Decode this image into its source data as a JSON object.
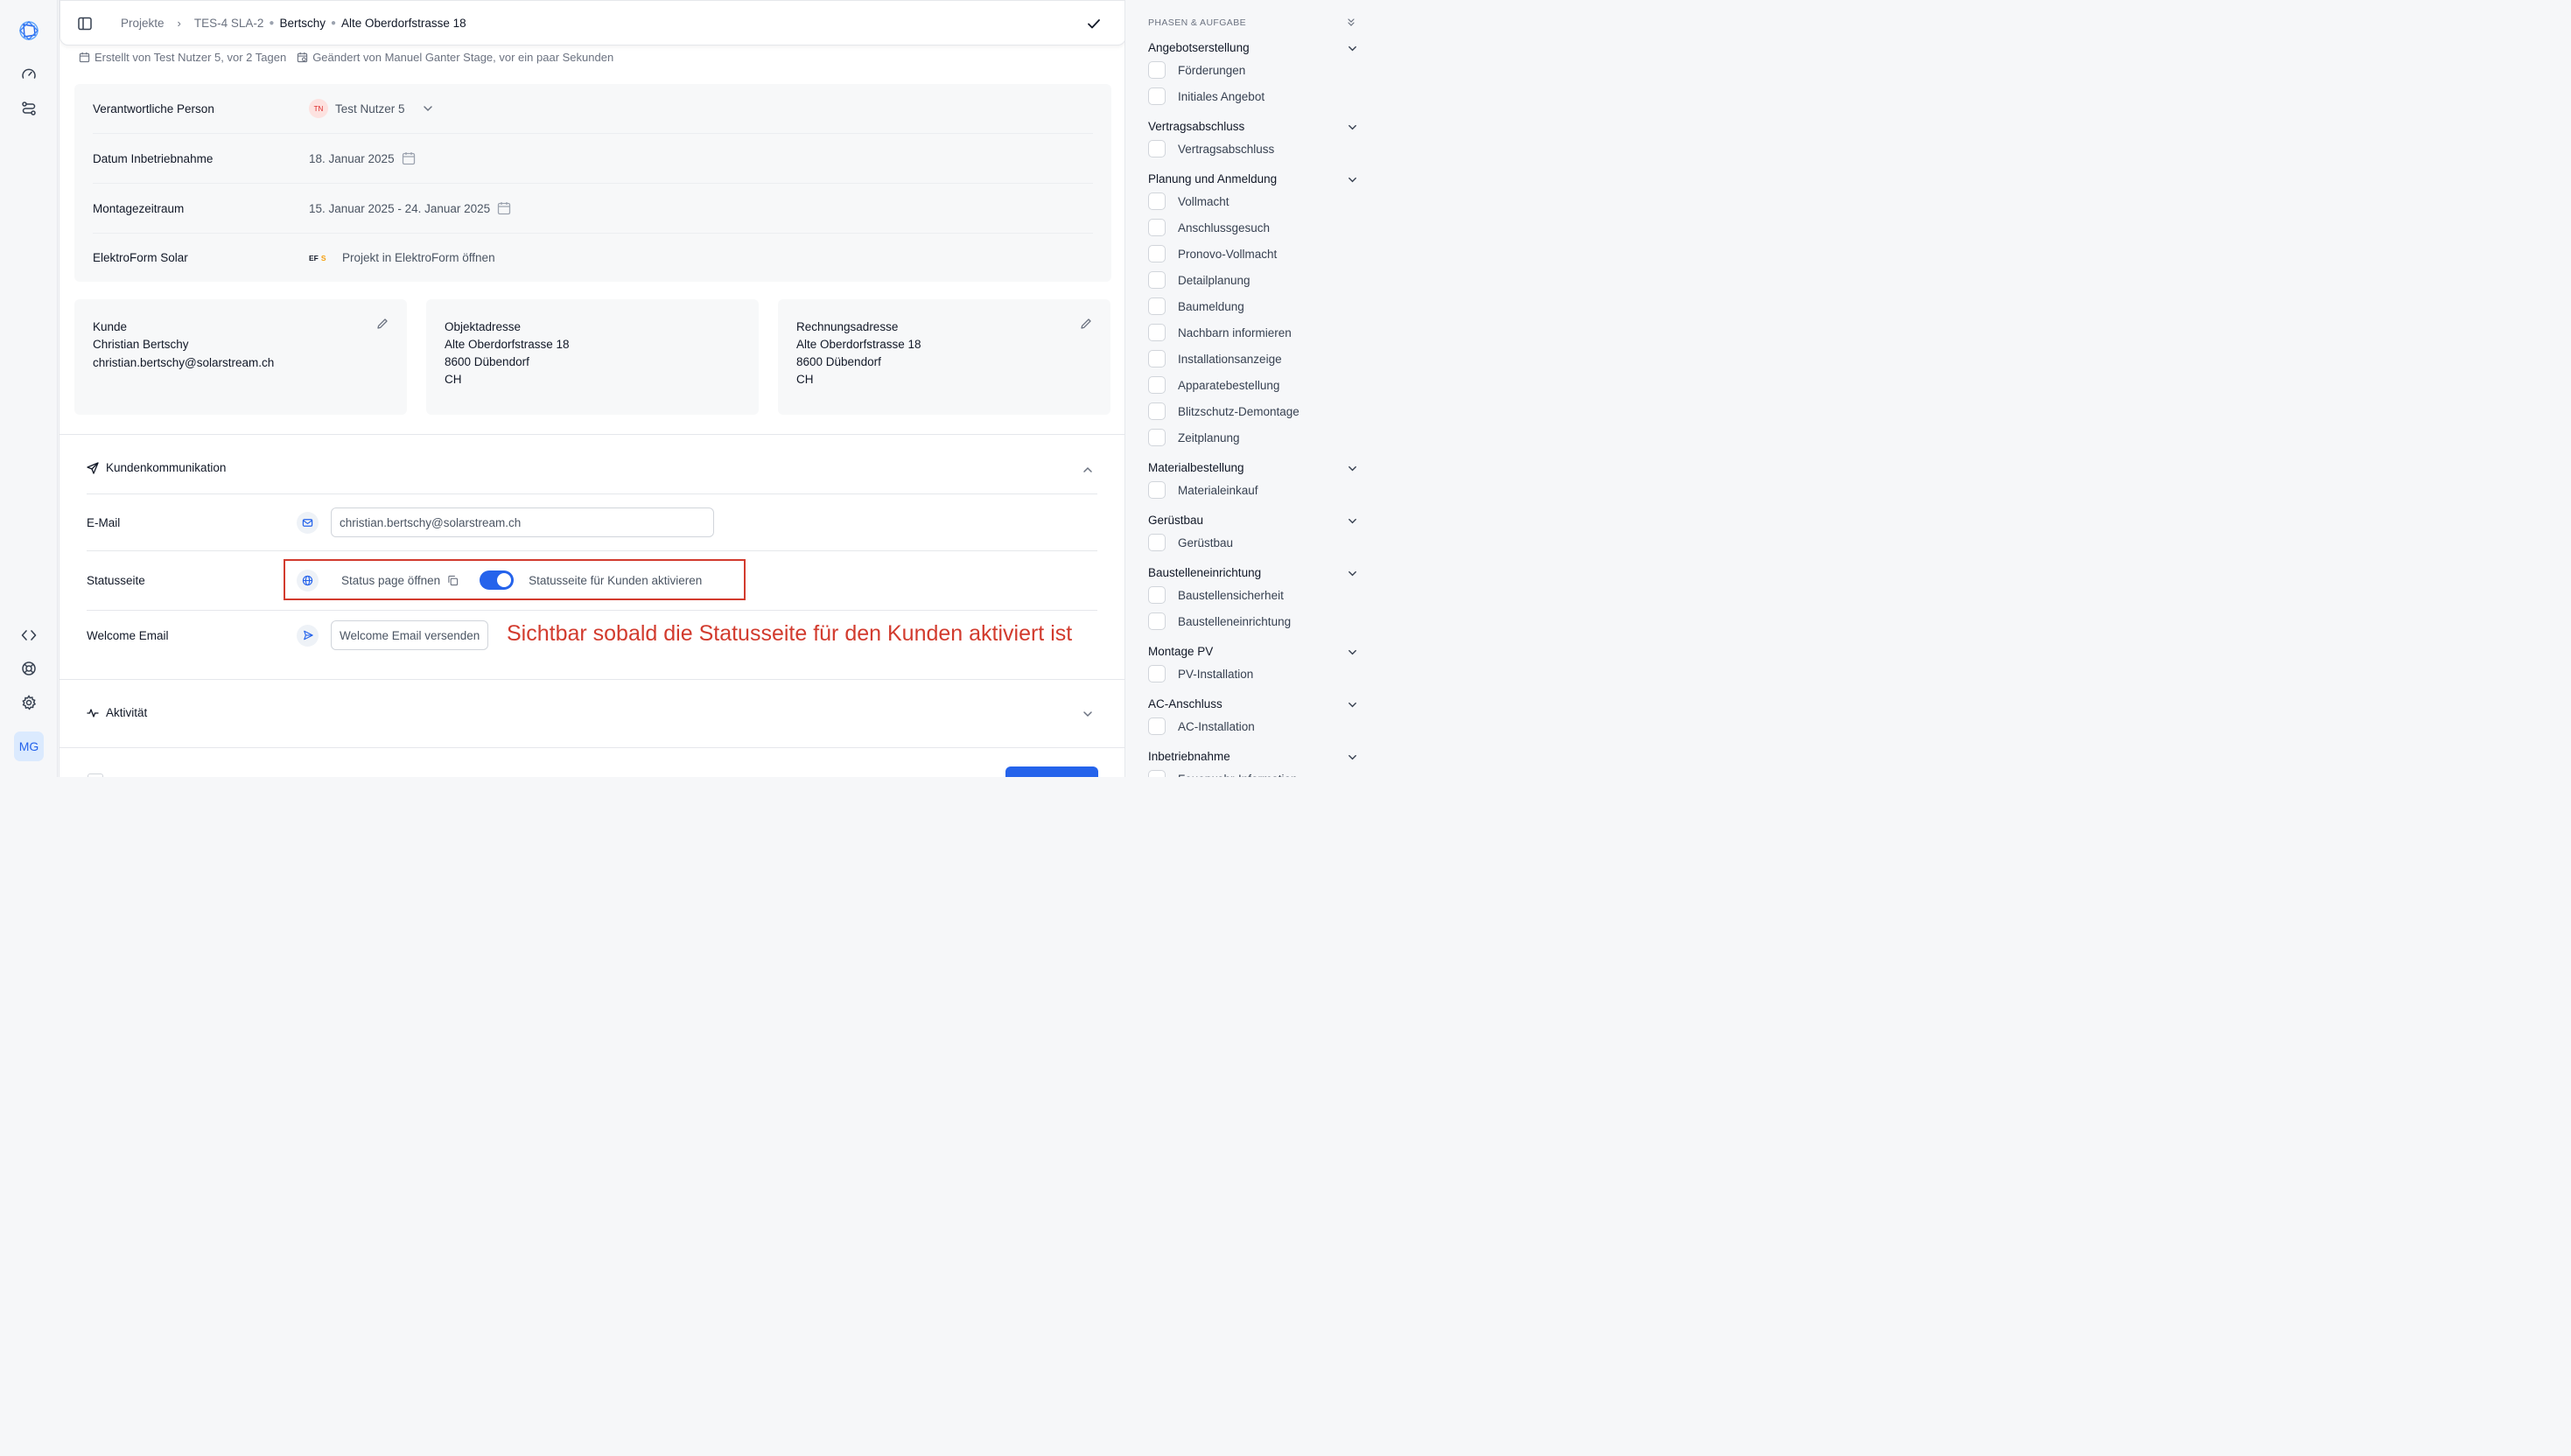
{
  "breadcrumb": {
    "root": "Projekte",
    "project_id": "TES-4 SLA-2",
    "customer": "Bertschy",
    "address": "Alte Oberdorfstrasse 18"
  },
  "meta": {
    "created": "Erstellt von Test Nutzer 5, vor 2 Tagen",
    "modified": "Geändert von Manuel Ganter Stage, vor ein paar Sekunden"
  },
  "fields": {
    "responsible_label": "Verantwortliche Person",
    "responsible_initials": "TN",
    "responsible_name": "Test Nutzer 5",
    "commissioning_label": "Datum Inbetriebnahme",
    "commissioning_date": "18. Januar 2025",
    "assembly_label": "Montagezeitraum",
    "assembly_range": "15. Januar 2025 - 24. Januar 2025",
    "elektroform_label": "ElektroForm Solar",
    "elektroform_logo_ef": "EF",
    "elektroform_logo_s": "S",
    "elektroform_link": "Projekt in ElektroForm öffnen"
  },
  "cards": {
    "customer": {
      "title": "Kunde",
      "name": "Christian Bertschy",
      "email": "christian.bertschy@solarstream.ch"
    },
    "object": {
      "title": "Objektadresse",
      "street": "Alte Oberdorfstrasse 18",
      "city": "8600 Dübendorf",
      "country": "CH"
    },
    "billing": {
      "title": "Rechnungsadresse",
      "street": "Alte Oberdorfstrasse 18",
      "city": "8600 Dübendorf",
      "country": "CH"
    }
  },
  "communication": {
    "title": "Kundenkommunikation",
    "email_label": "E-Mail",
    "email_value": "christian.bertschy@solarstream.ch",
    "status_label": "Statusseite",
    "status_link": "Status page öffnen",
    "toggle_on": true,
    "toggle_label": "Statusseite für Kunden aktivieren",
    "welcome_label": "Welcome Email",
    "welcome_button": "Welcome Email versenden",
    "annotation": "Sichtbar sobald die Statusseite für den Kunden aktiviert ist"
  },
  "activity": {
    "title": "Aktivität"
  },
  "user": {
    "initials": "MG"
  },
  "colors": {
    "accent": "#2563eb",
    "annotation": "#d23b2e"
  },
  "phases_panel": {
    "title": "PHASEN & AUFGABE",
    "phases": [
      {
        "name": "Angebotserstellung",
        "tasks": [
          "Förderungen",
          "Initiales Angebot"
        ]
      },
      {
        "name": "Vertragsabschluss",
        "tasks": [
          "Vertragsabschluss"
        ]
      },
      {
        "name": "Planung und Anmeldung",
        "tasks": [
          "Vollmacht",
          "Anschlussgesuch",
          "Pronovo-Vollmacht",
          "Detailplanung",
          "Baumeldung",
          "Nachbarn informieren",
          "Installationsanzeige",
          "Apparatebestellung",
          "Blitzschutz-Demontage",
          "Zeitplanung"
        ]
      },
      {
        "name": "Materialbestellung",
        "tasks": [
          "Materialeinkauf"
        ]
      },
      {
        "name": "Gerüstbau",
        "tasks": [
          "Gerüstbau"
        ]
      },
      {
        "name": "Baustelleneinrichtung",
        "tasks": [
          "Baustellensicherheit",
          "Baustelleneinrichtung"
        ]
      },
      {
        "name": "Montage PV",
        "tasks": [
          "PV-Installation"
        ]
      },
      {
        "name": "AC-Anschluss",
        "tasks": [
          "AC-Installation"
        ]
      },
      {
        "name": "Inbetriebnahme",
        "tasks": [
          "Feuerwehr-Information"
        ]
      }
    ]
  }
}
